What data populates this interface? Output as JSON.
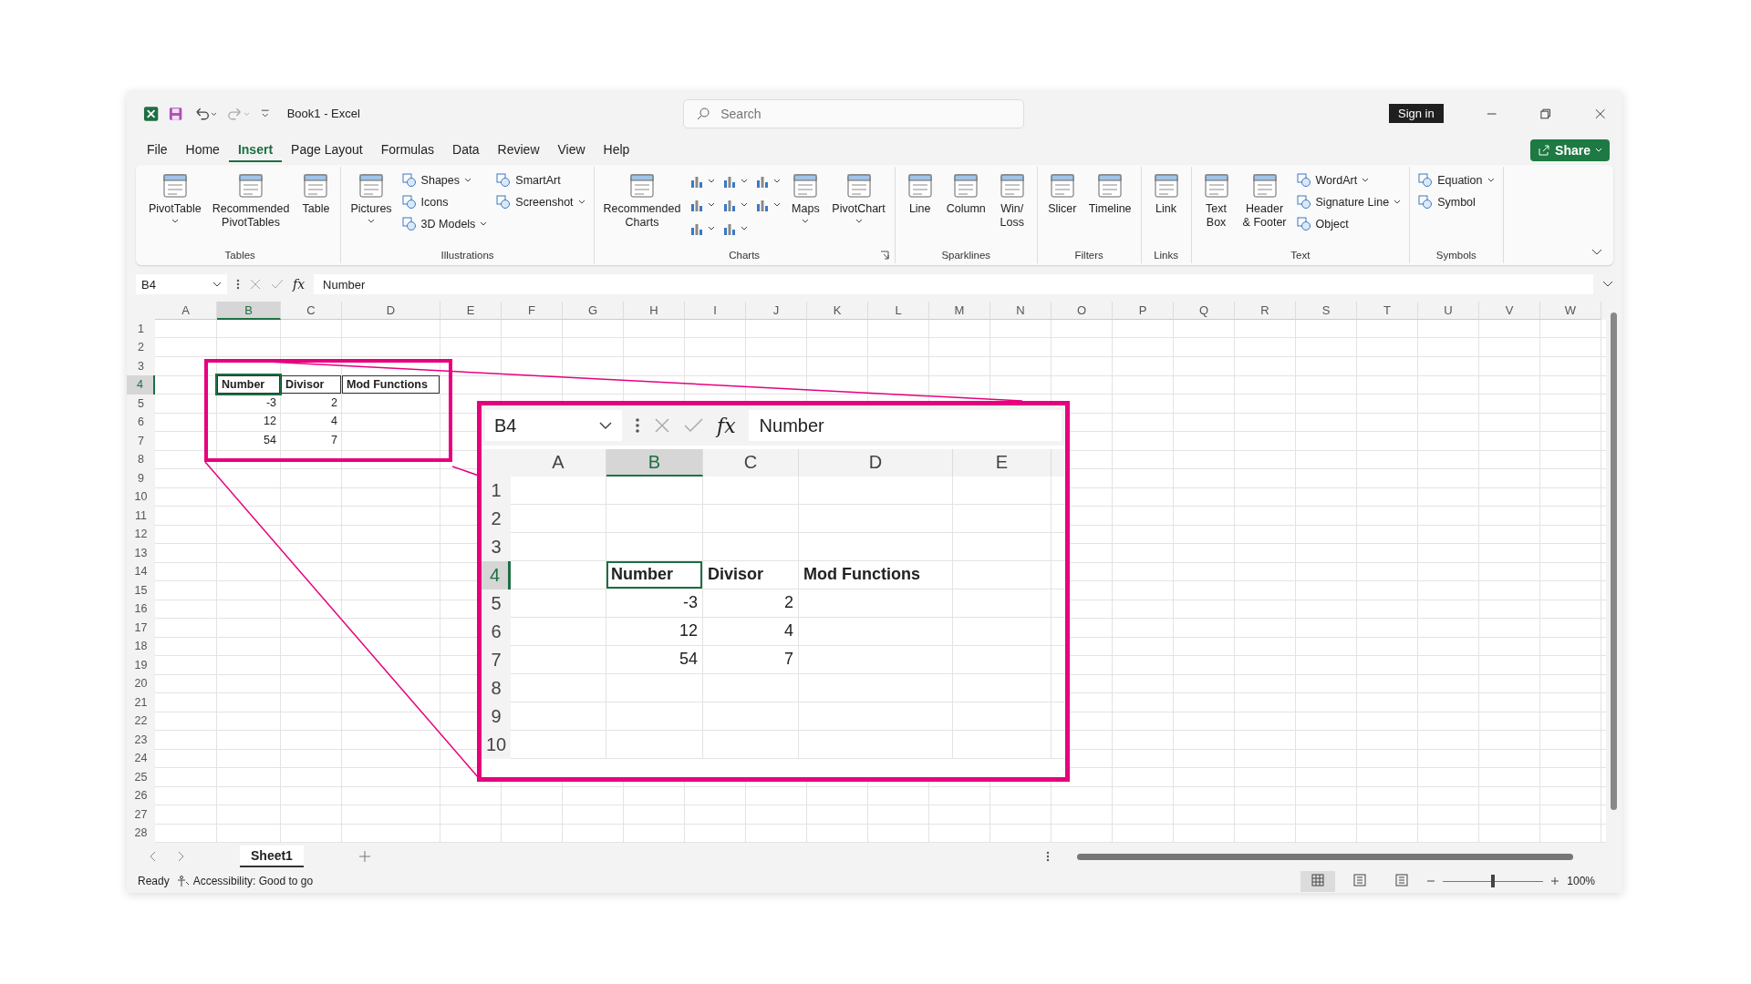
{
  "window": {
    "title": "Book1  -  Excel",
    "search_placeholder": "Search",
    "sign_in": "Sign in",
    "share": "Share"
  },
  "menu_tabs": [
    {
      "label": "File",
      "selected": false
    },
    {
      "label": "Home",
      "selected": false
    },
    {
      "label": "Insert",
      "selected": true
    },
    {
      "label": "Page Layout",
      "selected": false
    },
    {
      "label": "Formulas",
      "selected": false
    },
    {
      "label": "Data",
      "selected": false
    },
    {
      "label": "Review",
      "selected": false
    },
    {
      "label": "View",
      "selected": false
    },
    {
      "label": "Help",
      "selected": false
    }
  ],
  "ribbon_groups": [
    {
      "label": "Tables",
      "columns": [
        {
          "kind": "large",
          "label": "PivotTable",
          "dropdown": true
        },
        {
          "kind": "large",
          "label": "Recommended\nPivotTables",
          "dropdown": false
        },
        {
          "kind": "large",
          "label": "Table",
          "dropdown": false
        }
      ]
    },
    {
      "label": "Illustrations",
      "columns": [
        {
          "kind": "large",
          "label": "Pictures",
          "dropdown": true
        },
        {
          "kind": "stack",
          "items": [
            {
              "label": "Shapes",
              "dropdown": true
            },
            {
              "label": "Icons",
              "dropdown": false
            },
            {
              "label": "3D Models",
              "dropdown": true
            }
          ]
        },
        {
          "kind": "stack",
          "items": [
            {
              "label": "SmartArt",
              "dropdown": false
            },
            {
              "label": "Screenshot",
              "dropdown": true
            }
          ]
        }
      ]
    },
    {
      "label": "Charts",
      "launcher": true,
      "columns": [
        {
          "kind": "large",
          "label": "Recommended\nCharts",
          "dropdown": false
        },
        {
          "kind": "icons",
          "items": [
            {
              "dropdown": true
            },
            {
              "dropdown": true
            },
            {
              "dropdown": true
            }
          ]
        },
        {
          "kind": "icons",
          "items": [
            {
              "dropdown": true
            },
            {
              "dropdown": true
            },
            {
              "dropdown": true
            }
          ]
        },
        {
          "kind": "icons",
          "items": [
            {
              "dropdown": true
            },
            {
              "dropdown": true
            }
          ]
        },
        {
          "kind": "large",
          "label": "Maps",
          "dropdown": true
        },
        {
          "kind": "large",
          "label": "PivotChart",
          "dropdown": true
        }
      ]
    },
    {
      "label": "Sparklines",
      "columns": [
        {
          "kind": "large",
          "label": "Line",
          "dropdown": false
        },
        {
          "kind": "large",
          "label": "Column",
          "dropdown": false
        },
        {
          "kind": "large",
          "label": "Win/\nLoss",
          "dropdown": false
        }
      ]
    },
    {
      "label": "Filters",
      "columns": [
        {
          "kind": "large",
          "label": "Slicer",
          "dropdown": false
        },
        {
          "kind": "large",
          "label": "Timeline",
          "dropdown": false
        }
      ]
    },
    {
      "label": "Links",
      "columns": [
        {
          "kind": "large",
          "label": "Link",
          "dropdown": false
        }
      ]
    },
    {
      "label": "Text",
      "columns": [
        {
          "kind": "large",
          "label": "Text\nBox",
          "dropdown": false
        },
        {
          "kind": "large",
          "label": "Header\n& Footer",
          "dropdown": false
        },
        {
          "kind": "stack",
          "items": [
            {
              "label": "WordArt",
              "dropdown": true
            },
            {
              "label": "Signature Line",
              "dropdown": true
            },
            {
              "label": "Object",
              "dropdown": false
            }
          ]
        }
      ]
    },
    {
      "label": "Symbols",
      "columns": [
        {
          "kind": "stack",
          "items": [
            {
              "label": "Equation",
              "dropdown": true
            },
            {
              "label": "Symbol",
              "dropdown": false
            }
          ]
        }
      ]
    }
  ],
  "formula_bar": {
    "name_box": "B4",
    "function_label": "fx",
    "formula": "Number"
  },
  "sheet": {
    "columns": [
      {
        "label": "A",
        "selected": false
      },
      {
        "label": "B",
        "selected": true
      },
      {
        "label": "C",
        "selected": false
      },
      {
        "label": "D",
        "selected": false
      },
      {
        "label": "E",
        "selected": false
      },
      {
        "label": "F",
        "selected": false
      },
      {
        "label": "G",
        "selected": false
      },
      {
        "label": "H",
        "selected": false
      },
      {
        "label": "I",
        "selected": false
      },
      {
        "label": "J",
        "selected": false
      },
      {
        "label": "K",
        "selected": false
      },
      {
        "label": "L",
        "selected": false
      },
      {
        "label": "M",
        "selected": false
      },
      {
        "label": "N",
        "selected": false
      },
      {
        "label": "O",
        "selected": false
      },
      {
        "label": "P",
        "selected": false
      },
      {
        "label": "Q",
        "selected": false
      },
      {
        "label": "R",
        "selected": false
      },
      {
        "label": "S",
        "selected": false
      },
      {
        "label": "T",
        "selected": false
      },
      {
        "label": "U",
        "selected": false
      },
      {
        "label": "V",
        "selected": false
      },
      {
        "label": "W",
        "selected": false
      }
    ],
    "rows": [
      {
        "label": "1",
        "selected": false
      },
      {
        "label": "2",
        "selected": false
      },
      {
        "label": "3",
        "selected": false
      },
      {
        "label": "4",
        "selected": true,
        "B": {
          "text": "Number",
          "kind": "header",
          "selected": true
        },
        "C": {
          "text": "Divisor",
          "kind": "header",
          "selected": false
        },
        "D": {
          "text": "Mod Functions",
          "kind": "header",
          "selected": false
        }
      },
      {
        "label": "5",
        "selected": false,
        "B": {
          "text": "-3",
          "kind": "number",
          "selected": false
        },
        "C": {
          "text": "2",
          "kind": "number",
          "selected": false
        }
      },
      {
        "label": "6",
        "selected": false,
        "B": {
          "text": "12",
          "kind": "number",
          "selected": false
        },
        "C": {
          "text": "4",
          "kind": "number",
          "selected": false
        }
      },
      {
        "label": "7",
        "selected": false,
        "B": {
          "text": "54",
          "kind": "number",
          "selected": false
        },
        "C": {
          "text": "7",
          "kind": "number",
          "selected": false
        }
      },
      {
        "label": "8",
        "selected": false
      },
      {
        "label": "9",
        "selected": false
      },
      {
        "label": "10",
        "selected": false
      },
      {
        "label": "11",
        "selected": false
      },
      {
        "label": "12",
        "selected": false
      },
      {
        "label": "13",
        "selected": false
      },
      {
        "label": "14",
        "selected": false
      },
      {
        "label": "15",
        "selected": false
      },
      {
        "label": "16",
        "selected": false
      },
      {
        "label": "17",
        "selected": false
      },
      {
        "label": "18",
        "selected": false
      },
      {
        "label": "19",
        "selected": false
      },
      {
        "label": "20",
        "selected": false
      },
      {
        "label": "21",
        "selected": false
      },
      {
        "label": "22",
        "selected": false
      },
      {
        "label": "23",
        "selected": false
      },
      {
        "label": "24",
        "selected": false
      },
      {
        "label": "25",
        "selected": false
      },
      {
        "label": "26",
        "selected": false
      },
      {
        "label": "27",
        "selected": false
      },
      {
        "label": "28",
        "selected": false
      }
    ]
  },
  "zoom_inset": {
    "name_box": "B4",
    "function_label": "fx",
    "formula": "Number",
    "columns": [
      {
        "label": "A",
        "selected": false
      },
      {
        "label": "B",
        "selected": true
      },
      {
        "label": "C",
        "selected": false
      },
      {
        "label": "D",
        "selected": false
      },
      {
        "label": "E",
        "selected": false
      }
    ],
    "rows": [
      {
        "label": "1",
        "selected": false
      },
      {
        "label": "2",
        "selected": false
      },
      {
        "label": "3",
        "selected": false
      },
      {
        "label": "4",
        "selected": true,
        "B": {
          "text": "Number",
          "kind": "header",
          "selected": true
        },
        "C": {
          "text": "Divisor",
          "kind": "header",
          "selected": false
        },
        "D": {
          "text": "Mod Functions",
          "kind": "header",
          "selected": false
        }
      },
      {
        "label": "5",
        "selected": false,
        "B": {
          "text": "-3",
          "kind": "number",
          "selected": false
        },
        "C": {
          "text": "2",
          "kind": "number",
          "selected": false
        }
      },
      {
        "label": "6",
        "selected": false,
        "B": {
          "text": "12",
          "kind": "number",
          "selected": false
        },
        "C": {
          "text": "4",
          "kind": "number",
          "selected": false
        }
      },
      {
        "label": "7",
        "selected": false,
        "B": {
          "text": "54",
          "kind": "number",
          "selected": false
        },
        "C": {
          "text": "7",
          "kind": "number",
          "selected": false
        }
      },
      {
        "label": "8",
        "selected": false
      },
      {
        "label": "9",
        "selected": false
      },
      {
        "label": "10",
        "selected": false
      }
    ]
  },
  "sheet_tabs": [
    {
      "label": "Sheet1",
      "selected": true
    }
  ],
  "status_bar": {
    "status": "Ready",
    "accessibility": "Accessibility: Good to go",
    "views": [
      {
        "selected": true
      },
      {
        "selected": false
      },
      {
        "selected": false
      }
    ],
    "zoom": {
      "level": 0.5
    },
    "zoom_label": "100%"
  }
}
